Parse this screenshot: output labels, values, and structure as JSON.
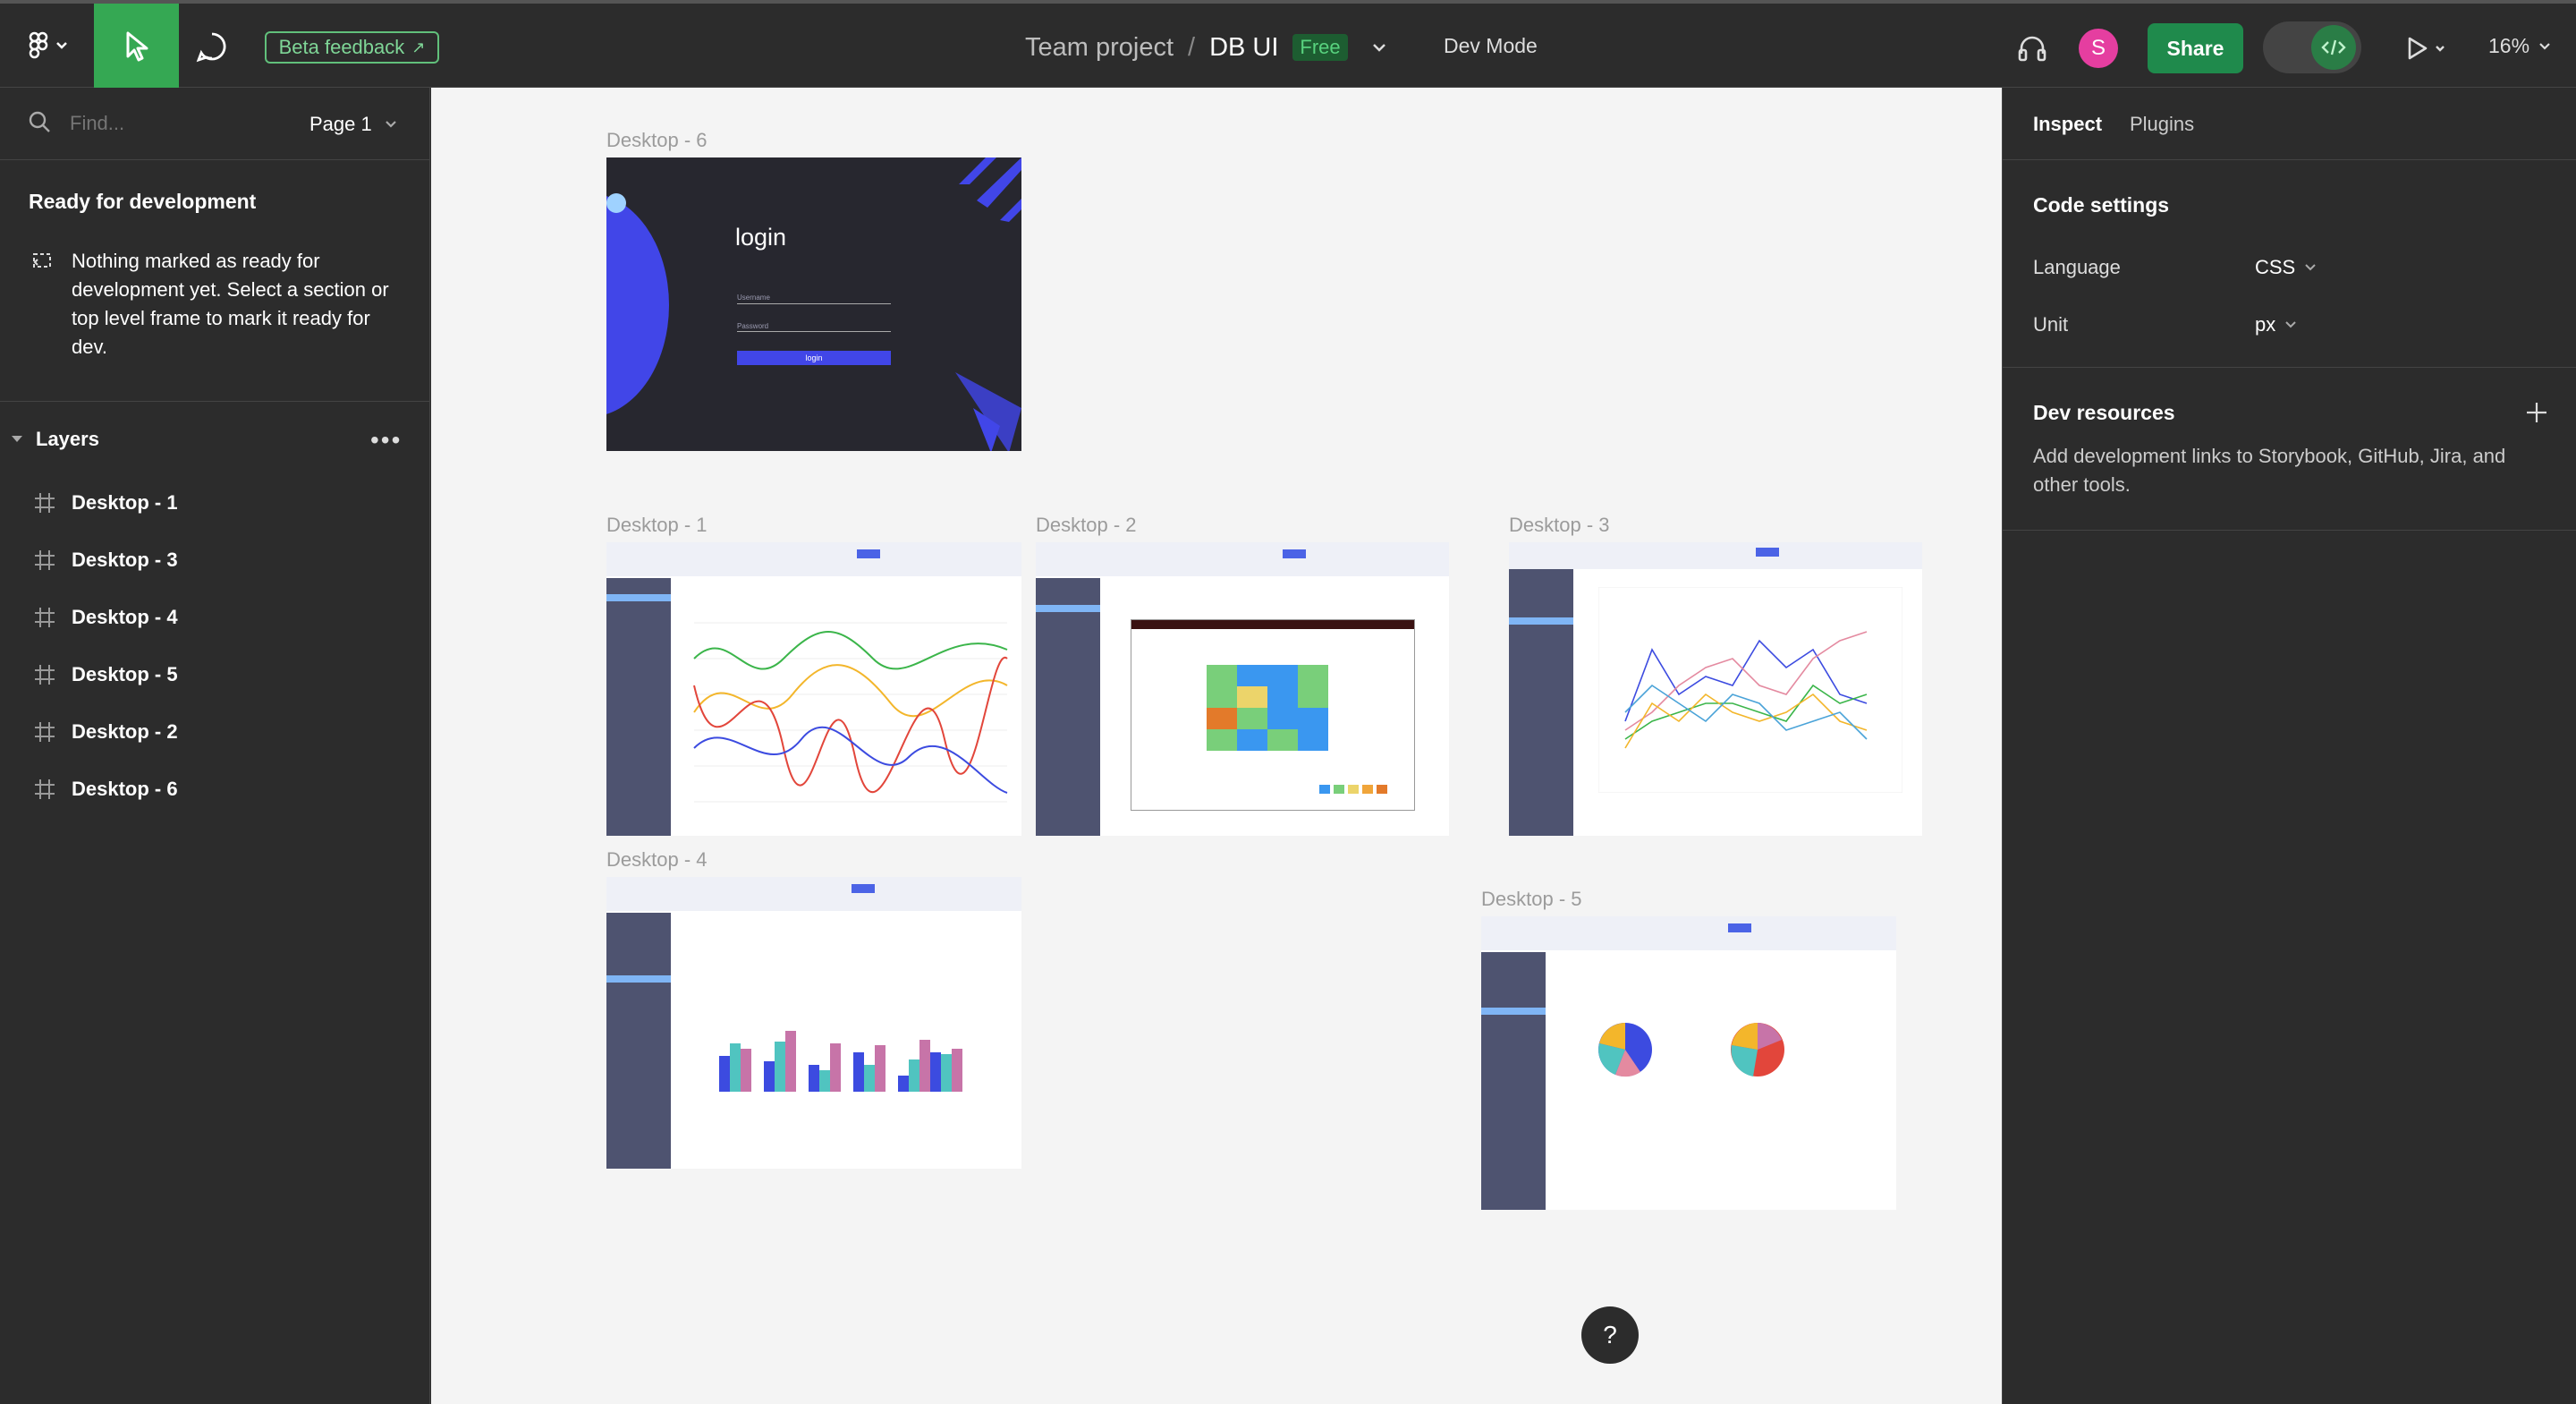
{
  "toolbar": {
    "beta_feedback": "Beta feedback",
    "team": "Team project",
    "slash": "/",
    "file": "DB UI",
    "plan_badge": "Free",
    "dev_mode": "Dev Mode",
    "avatar_initial": "S",
    "share": "Share",
    "zoom": "16%"
  },
  "left": {
    "find_placeholder": "Find...",
    "page": "Page 1",
    "ready_title": "Ready for development",
    "ready_body": "Nothing marked as ready for development yet. Select a section or top level frame to mark it ready for dev.",
    "layers_title": "Layers",
    "layers": [
      "Desktop - 1",
      "Desktop - 3",
      "Desktop - 4",
      "Desktop - 5",
      "Desktop - 2",
      "Desktop - 6"
    ]
  },
  "canvas": {
    "frames": {
      "d6": "Desktop - 6",
      "d1": "Desktop - 1",
      "d2": "Desktop - 2",
      "d3": "Desktop - 3",
      "d4": "Desktop - 4",
      "d5": "Desktop - 5"
    },
    "login": {
      "title": "login",
      "username": "Username",
      "password": "Password",
      "button": "login"
    }
  },
  "right": {
    "tab_inspect": "Inspect",
    "tab_plugins": "Plugins",
    "code_settings": "Code settings",
    "language_label": "Language",
    "language_value": "CSS",
    "unit_label": "Unit",
    "unit_value": "px",
    "dev_resources": "Dev resources",
    "dev_resources_body": "Add development links to Storybook, GitHub, Jira, and other tools."
  },
  "colors": {
    "accent_green": "#35a853",
    "share_green": "#1f8a4c",
    "avatar_pink": "#e53ea0",
    "login_bg": "#27272f",
    "login_blue": "#4146e8"
  },
  "help": "?"
}
